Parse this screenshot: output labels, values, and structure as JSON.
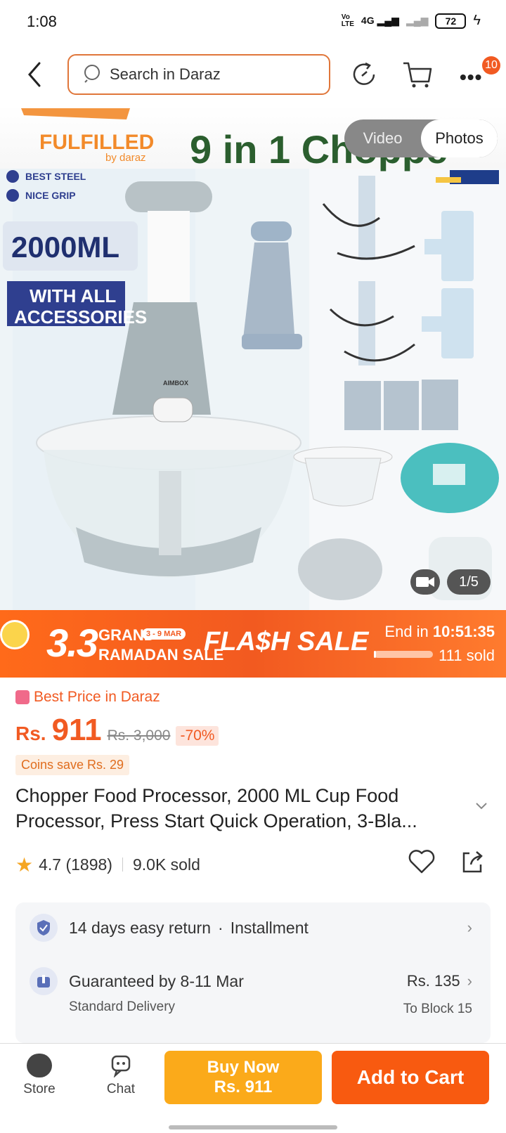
{
  "status_bar": {
    "time": "1:08",
    "network": "4G",
    "battery": "72"
  },
  "header": {
    "search_placeholder": "Search in Daraz",
    "cart_badge": "10"
  },
  "gallery": {
    "tabs": [
      "Video",
      "Photos"
    ],
    "active_tab": "Photos",
    "counter": "1/5",
    "image_texts": {
      "fulfilled": "FULFILLED",
      "by_daraz": "by daraz",
      "headline": "9 in 1 Choppe",
      "feature_1": "BEST STEEL",
      "feature_2": "NICE GRIP",
      "capacity": "2000ML",
      "accessories_1": "WITH ALL",
      "accessories_2": "ACCESSORIES",
      "brand": "AIMBOX"
    }
  },
  "flash": {
    "big_number": "3.3",
    "grand": "GRAND",
    "ramadan": "RAMADAN SALE",
    "dates": "3 - 9 MAR",
    "label": "FLA$H SALE",
    "end_label": "End in",
    "countdown": "10:51:35",
    "sold": "111 sold",
    "sold_progress": 0.04
  },
  "price": {
    "best_price": "Best Price in Daraz",
    "currency": "Rs.",
    "amount": "911",
    "original": "Rs. 3,000",
    "discount": "-70%",
    "coins": "Coins save Rs. 29"
  },
  "product": {
    "title": "Chopper Food Processor, 2000 ML Cup Food Processor, Press Start Quick Operation, 3-Bla...",
    "rating": "4.7",
    "reviews": "(1898)",
    "sold": "9.0K sold"
  },
  "delivery": {
    "return": "14 days easy return",
    "dot": "·",
    "installment": "Installment",
    "guarantee": "Guaranteed by 8-11 Mar",
    "standard": "Standard Delivery",
    "fee": "Rs. 135",
    "location": "To Block 15"
  },
  "bottom": {
    "store": "Store",
    "chat": "Chat",
    "buy_now_label": "Buy Now",
    "buy_now_price": "Rs. 911",
    "add_to_cart": "Add to Cart"
  },
  "colors": {
    "accent": "#f15a22",
    "buy_now": "#fbaa1a",
    "add_to_cart": "#f85a10"
  }
}
